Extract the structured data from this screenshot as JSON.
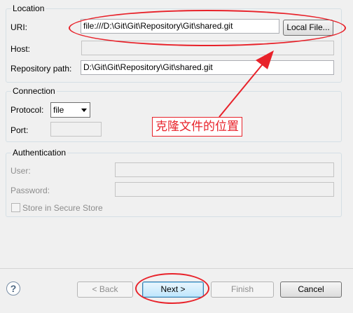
{
  "location": {
    "title": "Location",
    "uri_label": "URI:",
    "uri_value": "file:///D:\\Git\\Git\\Repository\\Git\\shared.git",
    "local_file_button": "Local File...",
    "host_label": "Host:",
    "host_value": "",
    "repo_path_label": "Repository path:",
    "repo_path_value": "D:\\Git\\Git\\Repository\\Git\\shared.git"
  },
  "connection": {
    "title": "Connection",
    "protocol_label": "Protocol:",
    "protocol_value": "file",
    "port_label": "Port:",
    "port_value": ""
  },
  "authentication": {
    "title": "Authentication",
    "user_label": "User:",
    "password_label": "Password:",
    "store_label": "Store in Secure Store"
  },
  "annotation": {
    "text": "克隆文件的位置",
    "color": "#e8222a"
  },
  "footer": {
    "help_icon": "?",
    "back_label": "< Back",
    "next_label": "Next >",
    "finish_label": "Finish",
    "cancel_label": "Cancel"
  }
}
